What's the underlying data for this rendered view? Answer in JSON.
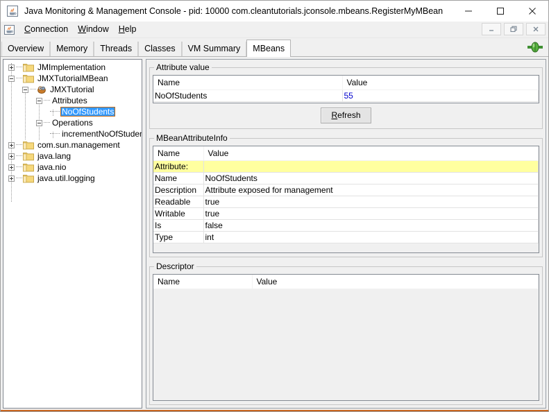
{
  "window": {
    "title": "Java Monitoring & Management Console - pid: 10000 com.cleantutorials.jconsole.mbeans.RegisterMyMBean",
    "icon": "java-cup-icon",
    "controls": {
      "minimize": "—",
      "maximize": "☐",
      "close": "✕"
    }
  },
  "menubar": {
    "icon": "java-cup-icon",
    "items": [
      {
        "label": "Connection",
        "mnemonic": "C"
      },
      {
        "label": "Window",
        "mnemonic": "W"
      },
      {
        "label": "Help",
        "mnemonic": "H"
      }
    ],
    "internal_controls": {
      "minimize": "–",
      "restore": "❐",
      "close": "✕"
    }
  },
  "tabs": {
    "items": [
      {
        "label": "Overview",
        "active": false
      },
      {
        "label": "Memory",
        "active": false
      },
      {
        "label": "Threads",
        "active": false
      },
      {
        "label": "Classes",
        "active": false
      },
      {
        "label": "VM Summary",
        "active": false
      },
      {
        "label": "MBeans",
        "active": true
      }
    ],
    "status_icon": "green-plug-connected-icon"
  },
  "tree": {
    "nodes": [
      {
        "label": "JMImplementation",
        "depth": 0,
        "handle": "plus",
        "icon": "folder-icon",
        "selected": false
      },
      {
        "label": "JMXTutorialMBean",
        "depth": 0,
        "handle": "minus",
        "icon": "folder-icon",
        "selected": false
      },
      {
        "label": "JMXTutorial",
        "depth": 1,
        "handle": "minus",
        "icon": "mbean-icon",
        "selected": false
      },
      {
        "label": "Attributes",
        "depth": 2,
        "handle": "minus",
        "icon": "none",
        "selected": false
      },
      {
        "label": "NoOfStudents",
        "depth": 3,
        "handle": "none",
        "icon": "none",
        "selected": true
      },
      {
        "label": "Operations",
        "depth": 2,
        "handle": "minus",
        "icon": "none",
        "selected": false
      },
      {
        "label": "incrementNoOfStudents",
        "depth": 3,
        "handle": "none",
        "icon": "none",
        "selected": false
      },
      {
        "label": "com.sun.management",
        "depth": 0,
        "handle": "plus",
        "icon": "folder-icon",
        "selected": false
      },
      {
        "label": "java.lang",
        "depth": 0,
        "handle": "plus",
        "icon": "folder-icon",
        "selected": false
      },
      {
        "label": "java.nio",
        "depth": 0,
        "handle": "plus",
        "icon": "folder-icon",
        "selected": false
      },
      {
        "label": "java.util.logging",
        "depth": 0,
        "handle": "plus",
        "icon": "folder-icon",
        "selected": false
      }
    ]
  },
  "attribute_value": {
    "legend": "Attribute value",
    "columns": [
      "Name",
      "Value"
    ],
    "rows": [
      {
        "name": "NoOfStudents",
        "value": "55"
      }
    ],
    "refresh_label": "Refresh",
    "refresh_mnemonic": "R"
  },
  "mbean_attribute_info": {
    "legend": "MBeanAttributeInfo",
    "columns": [
      "Name",
      "Value"
    ],
    "rows": [
      {
        "name": "Attribute:",
        "value": "",
        "highlight": true
      },
      {
        "name": "Name",
        "value": "NoOfStudents",
        "highlight": false
      },
      {
        "name": "Description",
        "value": "Attribute exposed for management",
        "highlight": false
      },
      {
        "name": "Readable",
        "value": "true",
        "highlight": false
      },
      {
        "name": "Writable",
        "value": "true",
        "highlight": false
      },
      {
        "name": "Is",
        "value": "false",
        "highlight": false
      },
      {
        "name": "Type",
        "value": "int",
        "highlight": false
      }
    ]
  },
  "descriptor": {
    "legend": "Descriptor",
    "columns": [
      "Name",
      "Value"
    ],
    "rows": []
  },
  "colors": {
    "highlight_row": "#ffff9f",
    "selection": "#3399ff",
    "selection_border": "#c06a16",
    "editable_value": "#0000cc",
    "folder": "#f5d67a",
    "accent_bottom": "#c8641e"
  }
}
